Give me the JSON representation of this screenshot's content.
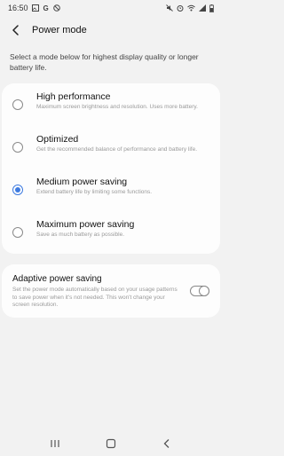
{
  "status_bar": {
    "time": "16:50",
    "left_icons": [
      "image-icon",
      "g-icon",
      "blocked-icon"
    ],
    "right_icons": [
      "mute-icon",
      "alarm-icon",
      "wifi-icon",
      "signal-icon",
      "battery-icon"
    ]
  },
  "app_bar": {
    "title": "Power mode"
  },
  "description": "Select a mode below for highest display quality or longer battery life.",
  "modes": [
    {
      "title": "High performance",
      "subtitle": "Maximum screen brightness and resolution. Uses more battery.",
      "selected": false
    },
    {
      "title": "Optimized",
      "subtitle": "Get the recommended balance of performance and battery life.",
      "selected": false
    },
    {
      "title": "Medium power saving",
      "subtitle": "Extend battery life by limiting some functions.",
      "selected": true
    },
    {
      "title": "Maximum power saving",
      "subtitle": "Save as much battery as possible.",
      "selected": false
    }
  ],
  "adaptive": {
    "title": "Adaptive power saving",
    "subtitle": "Set the power mode automatically based on your usage patterns to save power when it's not needed. This won't change your screen resolution.",
    "enabled": false
  },
  "accent_color": "#3e7be0",
  "nav": [
    "recents-icon",
    "home-icon",
    "back-icon"
  ]
}
